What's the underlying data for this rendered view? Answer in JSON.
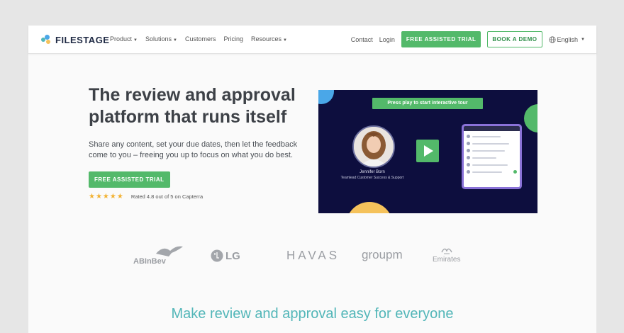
{
  "nav": {
    "logo_text": "FILESTAGE",
    "menu": [
      {
        "label": "Product",
        "has_dropdown": true
      },
      {
        "label": "Solutions",
        "has_dropdown": true
      },
      {
        "label": "Customers",
        "has_dropdown": false
      },
      {
        "label": "Pricing",
        "has_dropdown": false
      },
      {
        "label": "Resources",
        "has_dropdown": true
      }
    ],
    "contact": "Contact",
    "login": "Login",
    "trial_button": "FREE ASSISTED TRIAL",
    "demo_button": "BOOK A DEMO",
    "language": "English"
  },
  "hero": {
    "title": "The review and approval platform that runs itself",
    "subtitle": "Share any content, set your due dates, then let the feedback come to you – freeing you up to focus on what you do best.",
    "cta": "FREE ASSISTED TRIAL",
    "rating_text": "Rated 4.8 out of 5 on Capterra",
    "rating_stars": 4.8
  },
  "video": {
    "tour_button": "Press play to start interactive tour",
    "person_name": "Jennifer Born",
    "person_role": "Teamlead Customer Success & Support"
  },
  "logos": {
    "abinbev": "ABInBev",
    "lg": "LG",
    "havas": "HAVAS",
    "groupm": "groupm",
    "emirates": "Emirates"
  },
  "section": {
    "title": "Make review and approval easy for everyone"
  },
  "colors": {
    "accent_green": "#53b96a",
    "navy": "#0d0e3e",
    "teal_heading": "#52b6b8",
    "blue_circle": "#4aa7e8",
    "yellow_circle": "#f5c25b"
  }
}
